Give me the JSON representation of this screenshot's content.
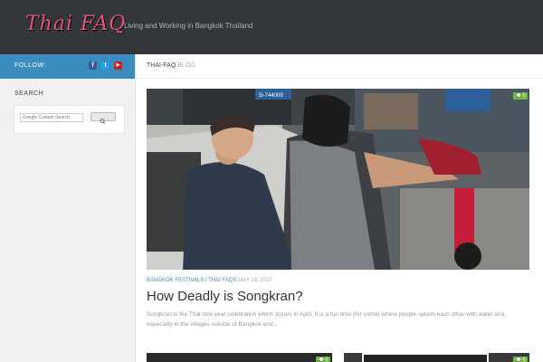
{
  "header": {
    "logo_text": "Thai FAQ",
    "tagline": "Living and Working in Bangkok Thailand"
  },
  "sidebar": {
    "follow_label": "FOLLOW:",
    "social": [
      {
        "icon": "facebook-icon",
        "glyph": "f",
        "color": "#3b5998"
      },
      {
        "icon": "twitter-icon",
        "glyph": "t",
        "color": "#1da1f2"
      },
      {
        "icon": "youtube-icon",
        "glyph": "▶",
        "color": "#cd201f"
      }
    ],
    "search_title": "SEARCH",
    "search_placeholder": "Google Custom Search"
  },
  "breadcrumb": {
    "site": "THAI-FAQ",
    "section": "BLOG"
  },
  "featured_post": {
    "categories": [
      "BANGKOK FESTIVALS",
      "THAI FAQS"
    ],
    "separator": "/",
    "date": "MAY 18, 2017",
    "title": "How Deadly is Songkran?",
    "excerpt": "Songkran is the Thai new year celebration which occurs in April.  It is a fun time (for some) where people splash each other with water and, especially in the villages outside of Bangkok and...",
    "comment_count": "0",
    "plate_text": "5i-744009"
  },
  "next_posts": [
    {
      "comment_count": "0"
    },
    {
      "comment_count": "0"
    }
  ],
  "colors": {
    "header_bg": "#33363b",
    "accent_blue": "#3b8dbd",
    "comment_green": "#74b844",
    "logo_pink": "#e5567c"
  }
}
